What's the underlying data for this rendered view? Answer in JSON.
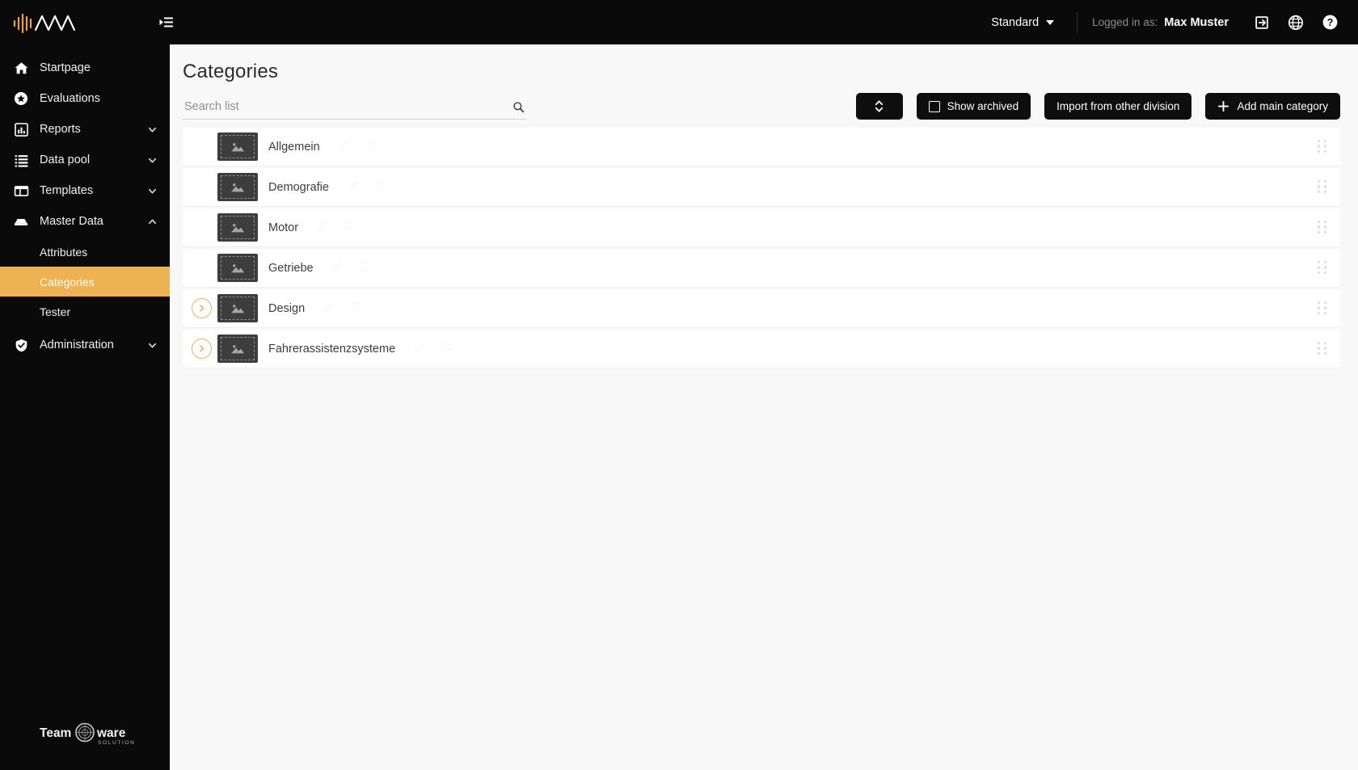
{
  "app": {
    "logo_alt": "AVA waveform logo",
    "footer_logo": {
      "part1": "Team",
      "part2": "ware",
      "tagline": "SOLUTIONS"
    }
  },
  "topbar": {
    "collapse_icon": "collapse-menu-icon",
    "division": {
      "value": "Standard",
      "caret_icon": "chevron-down-icon"
    },
    "logged_in_label": "Logged in as:",
    "user_name": "Max Muster",
    "icons": [
      {
        "name": "logout-icon",
        "title": "Logout"
      },
      {
        "name": "globe-icon",
        "title": "Language"
      },
      {
        "name": "help-icon",
        "title": "Help"
      }
    ]
  },
  "sidebar": {
    "items": [
      {
        "label": "Startpage",
        "icon": "home-icon",
        "expandable": false,
        "active": false
      },
      {
        "label": "Evaluations",
        "icon": "star-circle-icon",
        "expandable": false,
        "active": false
      },
      {
        "label": "Reports",
        "icon": "bar-chart-icon",
        "expandable": true,
        "expanded": false,
        "active": false
      },
      {
        "label": "Data pool",
        "icon": "list-icon",
        "expandable": true,
        "expanded": false,
        "active": false
      },
      {
        "label": "Templates",
        "icon": "layout-icon",
        "expandable": true,
        "expanded": false,
        "active": false
      },
      {
        "label": "Master Data",
        "icon": "database-icon",
        "expandable": true,
        "expanded": true,
        "active": false
      }
    ],
    "subitems": [
      {
        "label": "Attributes",
        "active": false
      },
      {
        "label": "Categories",
        "active": true
      },
      {
        "label": "Tester",
        "active": false
      }
    ],
    "bottom_items": [
      {
        "label": "Administration",
        "icon": "shield-check-icon",
        "expandable": true,
        "expanded": false,
        "active": false
      }
    ]
  },
  "main": {
    "title": "Categories",
    "search": {
      "placeholder": "Search list",
      "value": "",
      "icon": "search-icon"
    },
    "buttons": [
      {
        "name": "sort-button",
        "label": "",
        "icon": "sort-updown-icon"
      },
      {
        "name": "show-archived-button",
        "label": "Show archived",
        "icon": "checkbox-unchecked-icon"
      },
      {
        "name": "import-from-other-division-button",
        "label": "Import from other division",
        "icon": ""
      },
      {
        "name": "add-main-category-button",
        "label": "Add main category",
        "icon": "plus-icon"
      }
    ],
    "row_action_icons": {
      "edit": "pencil-icon",
      "add_sub": "add-subcategory-icon"
    },
    "drag_handle_icon": "drag-handle-icon",
    "expand_icon": "chevron-right-icon",
    "thumbnail_icon": "image-placeholder-icon",
    "rows": [
      {
        "name": "Allgemein",
        "expandable": false
      },
      {
        "name": "Demografie",
        "expandable": false
      },
      {
        "name": "Motor",
        "expandable": false
      },
      {
        "name": "Getriebe",
        "expandable": false
      },
      {
        "name": "Design",
        "expandable": true
      },
      {
        "name": "Fahrerassistenzsysteme",
        "expandable": true
      }
    ]
  },
  "colors": {
    "accent": "#edb252",
    "sidebar_bg": "#0a0a0a",
    "content_bg": "#f8f8f8",
    "row_bg": "#ffffff"
  }
}
